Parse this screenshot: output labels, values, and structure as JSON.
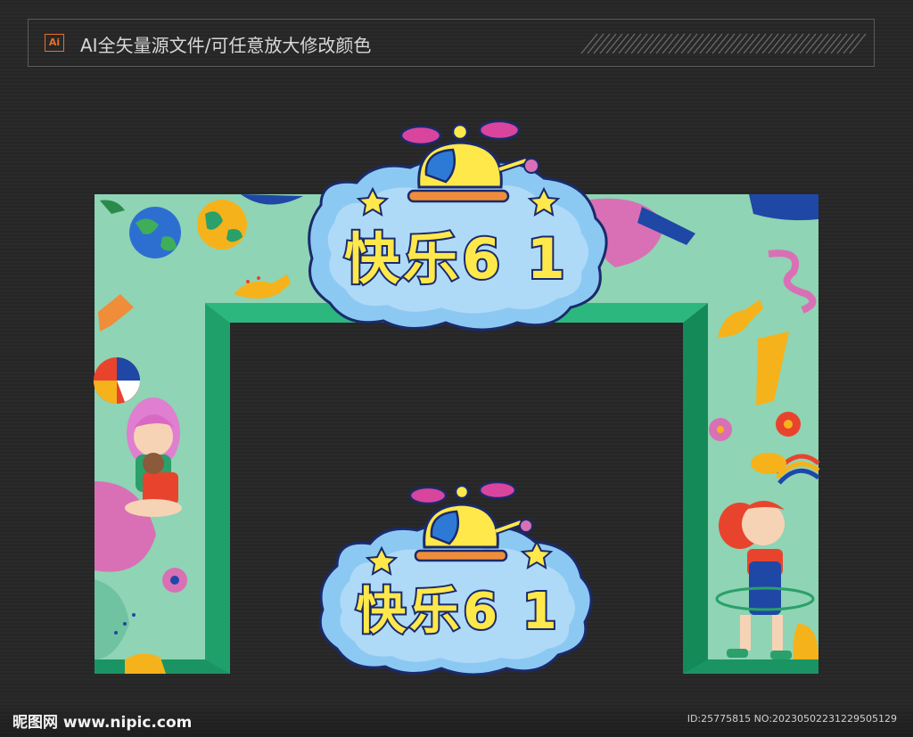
{
  "banner": {
    "badge": "Ai",
    "text": "AI全矢量源文件/可任意放大修改颜色"
  },
  "sign_top": {
    "title": "快乐6 1"
  },
  "sign_bottom": {
    "title": "快乐6 1"
  },
  "footer": {
    "site": "昵图网 www.nipic.com",
    "id": "ID:25775815 NO:20230502231229505129"
  },
  "colors": {
    "background": "#29292a",
    "arch_green": "#8fd4b4",
    "arch_edge": "#1f9e6a",
    "cloud_blue": "#8cc9f2",
    "title_yellow": "#ffe84a",
    "outline_navy": "#1b2a6b"
  },
  "icons": [
    "helicopter-icon",
    "star-icon",
    "globe-icon",
    "dinosaur-icon",
    "ball-icon",
    "flower-icon",
    "rainbow-icon",
    "lightbulb-icon"
  ]
}
